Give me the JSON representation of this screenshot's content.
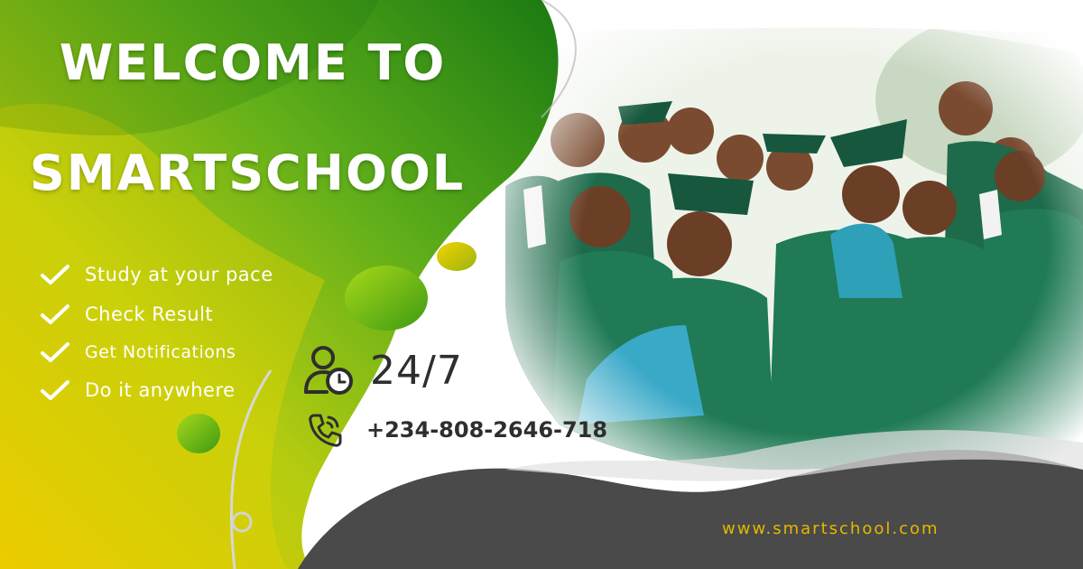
{
  "banner": {
    "title_line1": "WELCOME TO",
    "title_line2": "SMARTSCHOOL",
    "features": [
      "Study at your pace",
      "Check Result",
      "Get Notifications",
      "Do it anywhere"
    ],
    "availability": "24/7",
    "phone": "+234-808-2646-718",
    "website": "www.smartschool.com"
  },
  "photo": {
    "subject": "group of graduates in green gowns and caps"
  },
  "colors": {
    "green_dark": "#1f7d16",
    "green_light": "#7fc31c",
    "yellow": "#e3c400",
    "charcoal": "#4a4a4a",
    "gown_green": "#1d6b4a",
    "website_gold": "#e6b800"
  },
  "icons": {
    "check": "check-icon",
    "user_clock": "user-clock-icon",
    "phone": "phone-icon"
  }
}
